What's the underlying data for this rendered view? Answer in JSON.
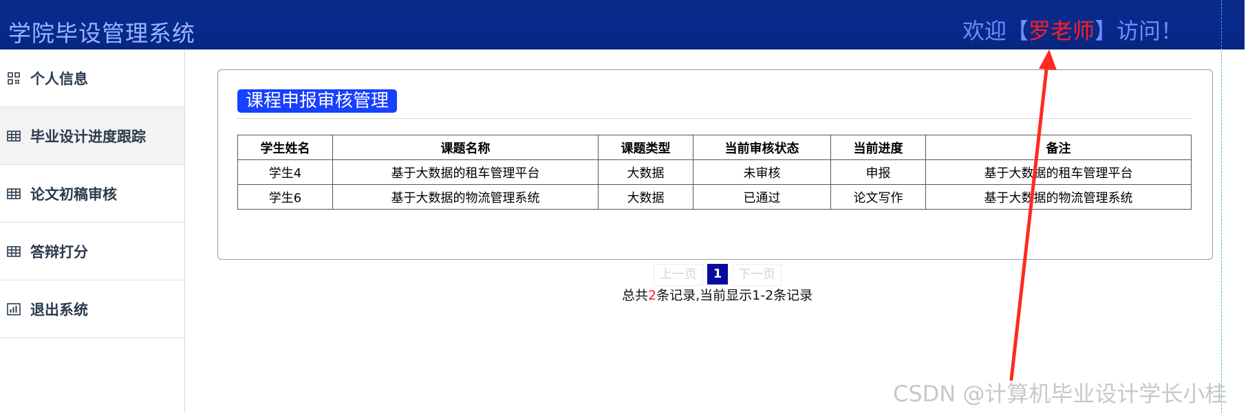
{
  "header": {
    "app_title": "学院毕设管理系统",
    "welcome_prefix": "欢迎【",
    "welcome_name": "罗老师",
    "welcome_suffix": "】访问！"
  },
  "sidebar": {
    "items": [
      {
        "label": "个人信息",
        "icon": "qr-code-icon"
      },
      {
        "label": "毕业设计进度跟踪",
        "icon": "grid-table-icon",
        "active": true
      },
      {
        "label": "论文初稿审核",
        "icon": "grid-table-icon"
      },
      {
        "label": "答辩打分",
        "icon": "grid-table-icon"
      },
      {
        "label": "退出系统",
        "icon": "bar-chart-icon"
      }
    ]
  },
  "panel": {
    "title": "课程申报审核管理",
    "table": {
      "headers": [
        "学生姓名",
        "课题名称",
        "课题类型",
        "当前审核状态",
        "当前进度",
        "备注"
      ],
      "rows": [
        [
          "学生4",
          "基于大数据的租车管理平台",
          "大数据",
          "未审核",
          "申报",
          "基于大数据的租车管理平台"
        ],
        [
          "学生6",
          "基于大数据的物流管理系统",
          "大数据",
          "已通过",
          "论文写作",
          "基于大数据的物流管理系统"
        ]
      ]
    }
  },
  "pagination": {
    "prev_label": "上一页",
    "current_page": "1",
    "next_label": "下一页",
    "summary_prefix": "总共",
    "total": "2",
    "summary_suffix": "条记录,当前显示1-2条记录"
  },
  "colors": {
    "header_bg": "#0a2a8a",
    "title_badge": "#1740ff",
    "highlight_red": "#ff1e1e",
    "arrow": "#ff2a1e"
  },
  "watermark": "CSDN @计算机毕业设计学长小桂"
}
